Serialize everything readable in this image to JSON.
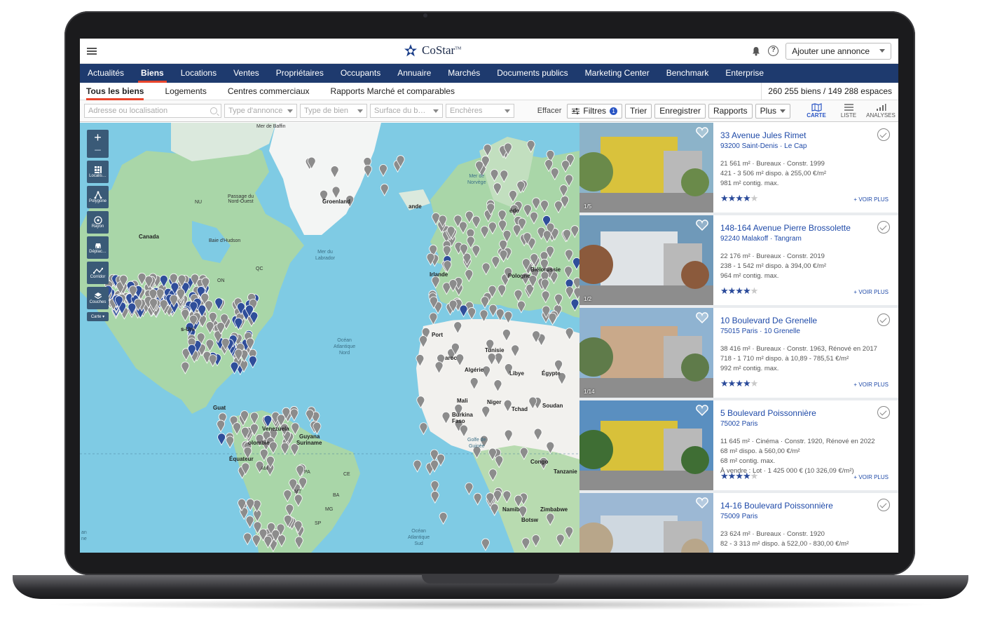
{
  "app": {
    "logo_text": "CoStar",
    "logo_mark": "TM"
  },
  "topbar": {
    "add_listing": "Ajouter une annonce"
  },
  "main_nav": [
    {
      "label": "Actualités"
    },
    {
      "label": "Biens",
      "active": true
    },
    {
      "label": "Locations"
    },
    {
      "label": "Ventes"
    },
    {
      "label": "Propriétaires"
    },
    {
      "label": "Occupants"
    },
    {
      "label": "Annuaire"
    },
    {
      "label": "Marchés"
    },
    {
      "label": "Documents publics"
    },
    {
      "label": "Marketing Center"
    },
    {
      "label": "Benchmark"
    },
    {
      "label": "Enterprise"
    }
  ],
  "sub_nav": {
    "items": [
      {
        "label": "Tous les biens",
        "active": true
      },
      {
        "label": "Logements"
      },
      {
        "label": "Centres commerciaux"
      },
      {
        "label": "Rapports Marché et comparables"
      }
    ],
    "count": "260 255 biens / 149 288 espaces"
  },
  "filters": {
    "search_placeholder": "Adresse ou localisation",
    "selects": [
      "Type d'annonce",
      "Type de bien",
      "Surface du b…",
      "Enchères"
    ],
    "clear": "Effacer",
    "buttons": {
      "filters": "Filtres",
      "filters_count": "1",
      "sort": "Trier",
      "save": "Enregistrer",
      "reports": "Rapports",
      "more": "Plus"
    },
    "views": {
      "map": "CARTE",
      "list": "LISTE",
      "analytics": "ANALYSES"
    }
  },
  "map": {
    "tools": {
      "location": "Localis…",
      "polygon": "Polygone",
      "radius": "Rayon",
      "travel": "Déplac…",
      "corridor": "Corridor",
      "layers": "Couches",
      "map_type": "Carte ▾"
    },
    "labels": {
      "baffin": "Mer de Baffin",
      "greenland": "Groenland",
      "norwegian": "Mer de\nNorvège",
      "canada": "Canada",
      "hudson": "Baie d'Hudson",
      "nw_passage": "Passage du\nNord-Ouest",
      "labrador": "Mer du\nLabrador",
      "n_atlantic": "Océan\nAtlantique\nNord",
      "s_atlantic": "Océan\nAtlantique\nSud",
      "ireland": "Irlande",
      "belarus": "Biélorussie",
      "poland": "Pologne",
      "portugal": "Port",
      "tunisia": "Tunisie",
      "algeria": "Algérie",
      "morocco": "aroc",
      "libya": "Libye",
      "egypt": "Égypte",
      "mali": "Mali",
      "niger": "Niger",
      "tchad": "Tchad",
      "soudan": "Soudan",
      "burkina": "Burkina\nFaso",
      "guinea_gulf": "Golfe de\nGuinée",
      "congo": "Congo",
      "tanzanie": "Tanzanie",
      "zimbabwe": "Zimbabwe",
      "namibie": "Namib",
      "botswana": "Botsw",
      "venezuela": "Venezuela",
      "guyana": "Guyana",
      "suriname": "Suriname",
      "colombie": "olombie",
      "equateur": "Équateur",
      "guat": "Guat",
      "etats_unis": "s-Uni",
      "norvege_land": "ède",
      "islande": "ande",
      "n": "N",
      "nu": "NU",
      "on": "ON",
      "qc": "QC",
      "am": "AM",
      "pa": "PA",
      "mt": "MT",
      "ba": "BA",
      "ce": "CE",
      "mg": "MG",
      "sp": "SP",
      "an": "an\nne"
    }
  },
  "listings": [
    {
      "title": "33 Avenue Jules Rimet",
      "city": "93200 Saint-Denis",
      "submarket": "Le Cap",
      "lines": [
        "21 561 m² · Bureaux · Constr. 1999",
        "421 - 3 506 m² dispo. à 255,00 €/m²",
        "981 m² contig. max."
      ],
      "rating": 4,
      "photos": "1/5",
      "more": "+ VOIR PLUS",
      "photo_colors": [
        "#d9c23c",
        "#8cb3c9",
        "#6a8a4a"
      ]
    },
    {
      "title": "148-164 Avenue Pierre Brossolette",
      "city": "92240 Malakoff",
      "submarket": "Tangram",
      "lines": [
        "22 176 m² · Bureaux · Constr. 2019",
        "238 - 1 542 m² dispo. à 394,00 €/m²",
        "964 m² contig. max."
      ],
      "rating": 4,
      "photos": "1/2",
      "more": "+ VOIR PLUS",
      "photo_colors": [
        "#dfe3e6",
        "#6f99b9",
        "#8b5a3c"
      ]
    },
    {
      "title": "10 Boulevard De Grenelle",
      "city": "75015 Paris",
      "submarket": "10 Grenelle",
      "lines": [
        "38 416 m² · Bureaux · Constr. 1963, Rénové en 2017",
        "718 - 1 710 m² dispo. à 10,89 - 785,51 €/m²",
        "992 m² contig. max."
      ],
      "rating": 4,
      "photos": "1/14",
      "more": "+ VOIR PLUS",
      "photo_colors": [
        "#c9a98a",
        "#8fb3d1",
        "#5f7b4a"
      ]
    },
    {
      "title": "5 Boulevard Poissonnière",
      "city": "75002 Paris",
      "submarket": "",
      "lines": [
        "11 645 m² · Cinéma · Constr. 1920, Rénové en 2022",
        "68 m² dispo. à 560,00 €/m²",
        "68 m² contig. max.",
        "À vendre : Lot · 1 425 000 € (10 326,09 €/m²)"
      ],
      "rating": 4,
      "photos": "",
      "more": "+ VOIR PLUS",
      "photo_colors": [
        "#d8c13a",
        "#5a8fc0",
        "#3f6e34"
      ]
    },
    {
      "title": "14-16 Boulevard Poissonnière",
      "city": "75009 Paris",
      "submarket": "",
      "lines": [
        "23 624 m² · Bureaux · Constr. 1920",
        "82 - 3 313 m² dispo. à 522,00 - 830,00 €/m²"
      ],
      "rating": 0,
      "photos": "",
      "more": "",
      "photo_colors": [
        "#cfd8e0",
        "#9cb8d4",
        "#b8a68a"
      ]
    }
  ]
}
